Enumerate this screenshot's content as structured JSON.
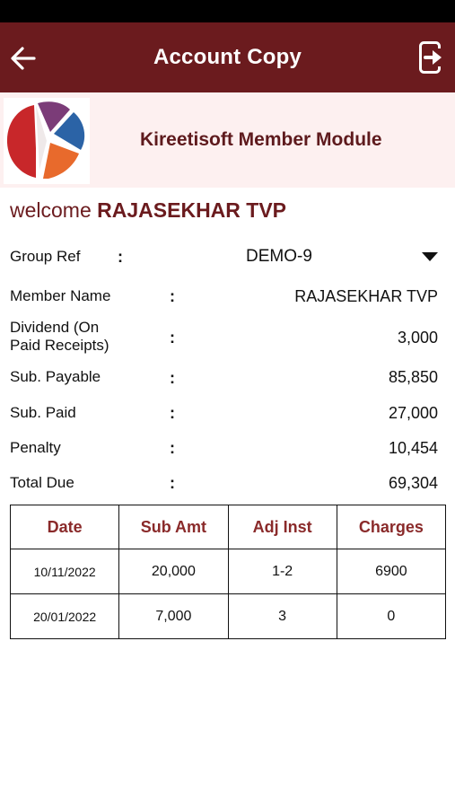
{
  "header": {
    "title": "Account Copy",
    "back_icon": "arrow-left-icon",
    "exit_icon": "exit-app-icon"
  },
  "brand": {
    "title": "Kireetisoft Member Module"
  },
  "welcome": {
    "word": "welcome",
    "name": "RAJASEKHAR TVP"
  },
  "details": {
    "group_ref_label": "Group Ref",
    "group_ref_value": "DEMO-9",
    "member_name_label": "Member Name",
    "member_name_value": "RAJASEKHAR TVP",
    "dividend_label_line1": "Dividend (On",
    "dividend_label_line2": "Paid Receipts)",
    "dividend_value": "3,000",
    "sub_payable_label": "Sub. Payable",
    "sub_payable_value": "85,850",
    "sub_paid_label": "Sub. Paid",
    "sub_paid_value": "27,000",
    "penalty_label": "Penalty",
    "penalty_value": "10,454",
    "total_due_label": "Total Due",
    "total_due_value": "69,304",
    "colon": ":"
  },
  "table": {
    "headers": [
      "Date",
      "Sub Amt",
      "Adj Inst",
      "Charges"
    ],
    "rows": [
      [
        "10/11/2022",
        "20,000",
        "1-2",
        "6900"
      ],
      [
        "20/01/2022",
        "7,000",
        "3",
        "0"
      ]
    ]
  },
  "colors": {
    "header_bg": "#6b1b1e",
    "brand_bg": "#fdf0f0",
    "accent_text": "#6b1b1e"
  }
}
